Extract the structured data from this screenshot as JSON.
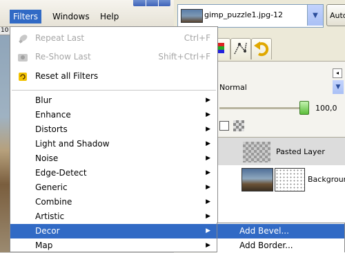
{
  "menubar": {
    "items": [
      {
        "label": "Filters",
        "active": true
      },
      {
        "label": "Windows",
        "active": false
      },
      {
        "label": "Help",
        "active": false
      }
    ]
  },
  "canvas": {
    "ruler_label": "10"
  },
  "filters_menu": {
    "top_items": [
      {
        "label": "Repeat Last",
        "shortcut": "Ctrl+F",
        "icon": "repeat-icon",
        "disabled": true
      },
      {
        "label": "Re-Show Last",
        "shortcut": "Shift+Ctrl+F",
        "icon": "reshow-icon",
        "disabled": true
      },
      {
        "label": "Reset all Filters",
        "shortcut": "",
        "icon": "reset-filters-icon",
        "disabled": false
      }
    ],
    "submenus": [
      {
        "label": "Blur"
      },
      {
        "label": "Enhance"
      },
      {
        "label": "Distorts"
      },
      {
        "label": "Light and Shadow"
      },
      {
        "label": "Noise"
      },
      {
        "label": "Edge-Detect"
      },
      {
        "label": "Generic"
      },
      {
        "label": "Combine"
      },
      {
        "label": "Artistic"
      },
      {
        "label": "Decor",
        "selected": true
      },
      {
        "label": "Map"
      }
    ]
  },
  "decor_submenu": {
    "items": [
      {
        "label": "Add Bevel...",
        "selected": true
      },
      {
        "label": "Add Border..."
      }
    ]
  },
  "dock": {
    "image_name": "gimp_puzzle1.jpg-12",
    "auto_label": "Auto",
    "mode_label": "Normal",
    "opacity_value": "100,0",
    "layers": [
      {
        "name": "Pasted Layer",
        "selected": true
      },
      {
        "name": "Background",
        "selected": false
      }
    ]
  },
  "colors": {
    "selection": "#316ac5",
    "disabled_text": "#a6a6a6"
  }
}
